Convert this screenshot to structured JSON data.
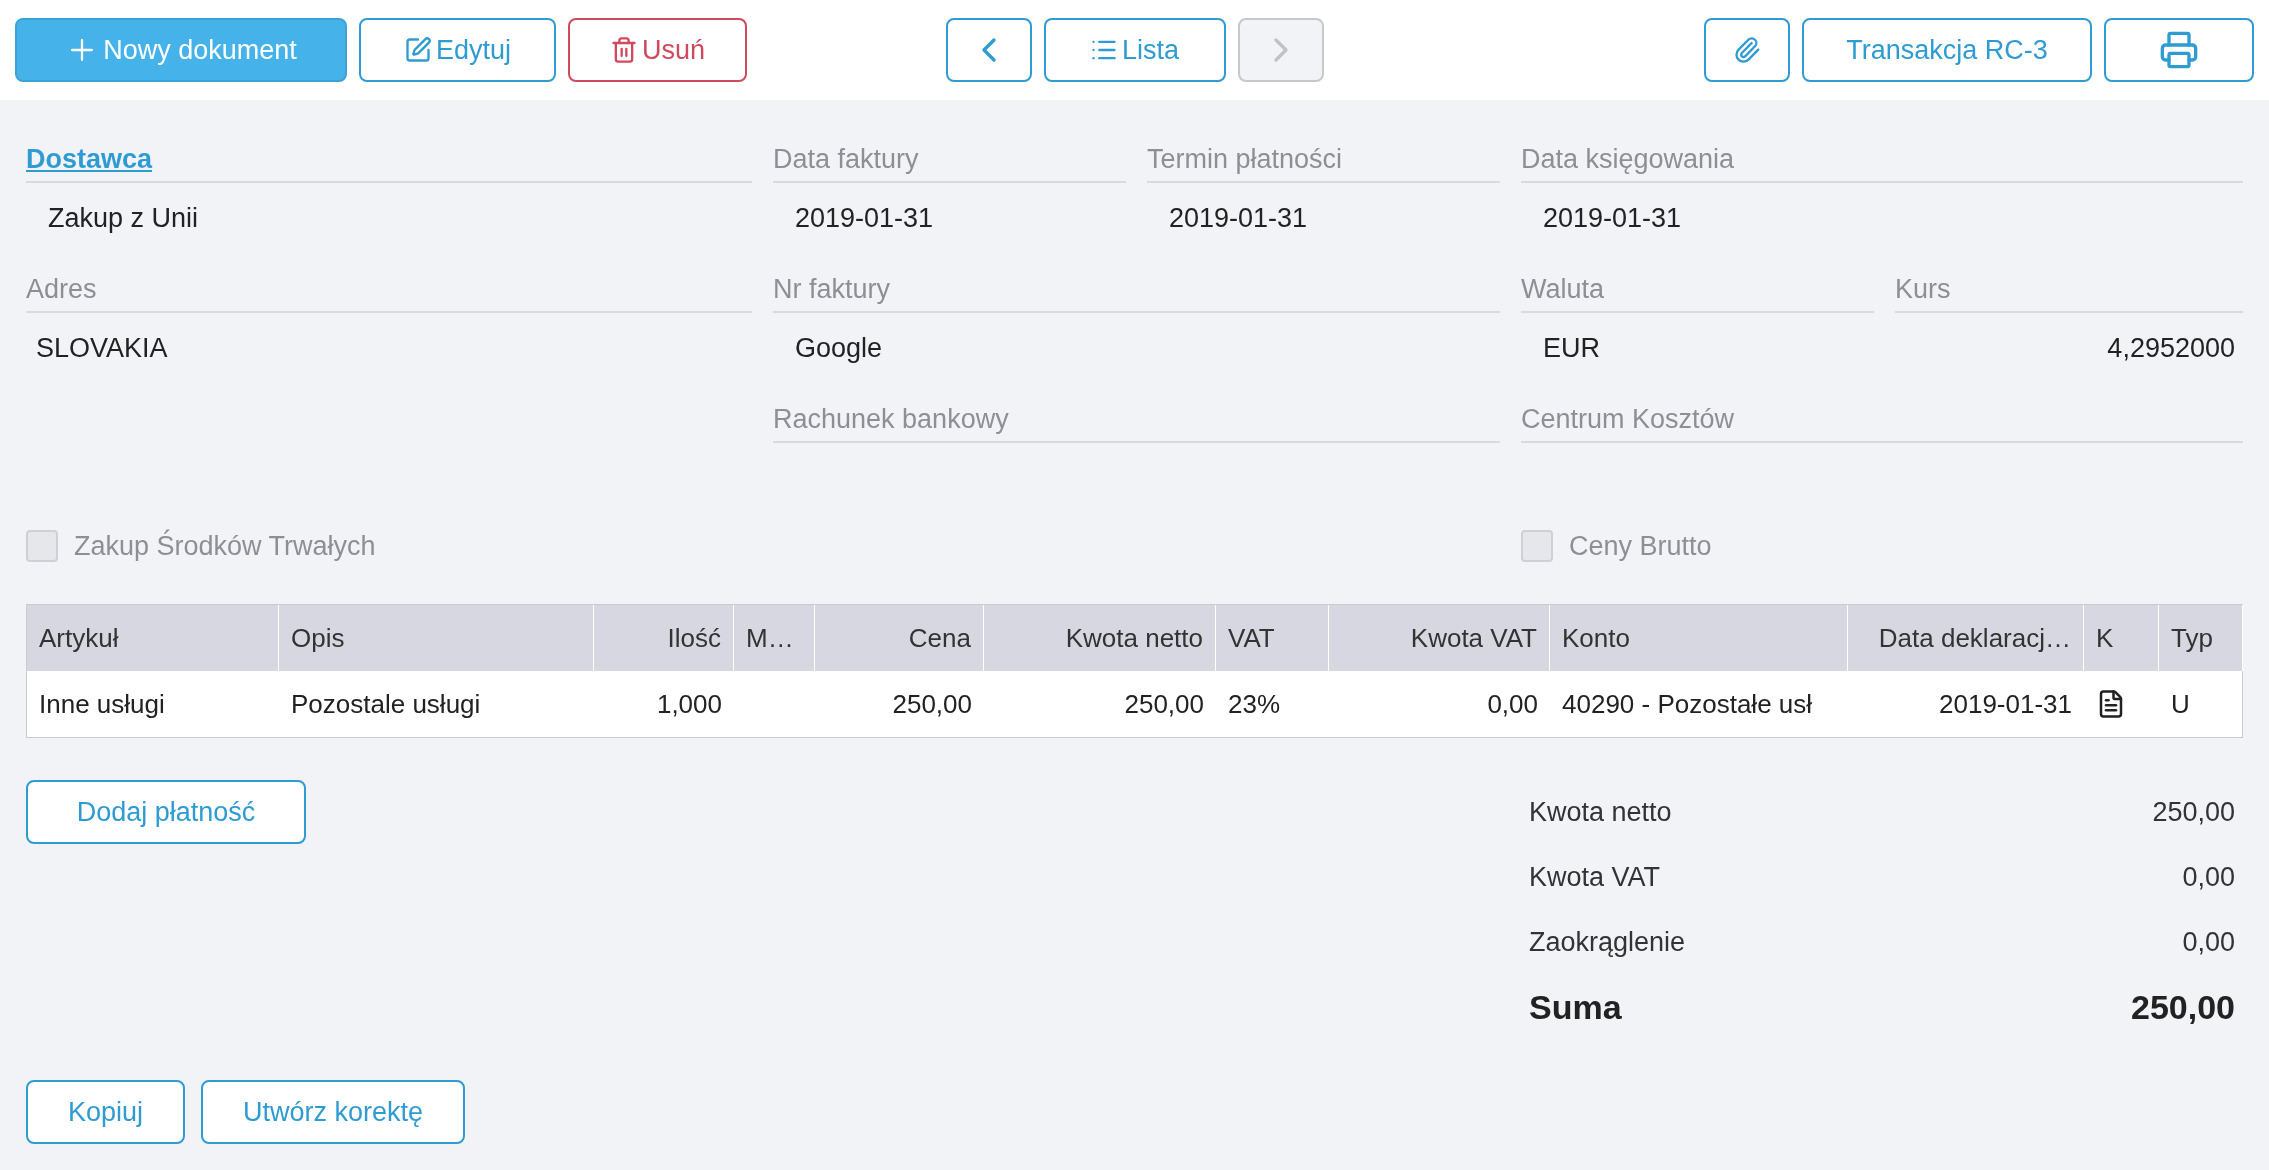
{
  "toolbar": {
    "new_button": {
      "label": "Nowy dokument"
    },
    "edit_button": {
      "label": "Edytuj"
    },
    "delete_button": {
      "label": "Usuń"
    },
    "prev_button": {
      "disabled": false
    },
    "list_button": {
      "label": "Lista"
    },
    "next_button": {
      "disabled": true
    },
    "transaction_button": {
      "label": "Transakcja RC-3"
    }
  },
  "form": {
    "supplier": {
      "label": "Dostawca",
      "value": "Zakup z Unii"
    },
    "invoice_date": {
      "label": "Data faktury",
      "value": "2019-01-31"
    },
    "due_date": {
      "label": "Termin płatności",
      "value": "2019-01-31"
    },
    "posting_date": {
      "label": "Data księgowania",
      "value": "2019-01-31"
    },
    "address": {
      "label": "Adres",
      "value": "SLOVAKIA"
    },
    "invoice_number": {
      "label": "Nr faktury",
      "value": "Google"
    },
    "currency": {
      "label": "Waluta",
      "value": "EUR"
    },
    "rate": {
      "label": "Kurs",
      "value": "4,2952000"
    },
    "bank_account": {
      "label": "Rachunek bankowy"
    },
    "cost_center": {
      "label": "Centrum Kosztów"
    }
  },
  "checkboxes": [
    {
      "label": "Zakup Środków Trwałych",
      "checked": false
    },
    {
      "label": "Ceny Brutto",
      "checked": false
    }
  ],
  "table": {
    "columns": [
      {
        "label": "Artykuł",
        "numeric": false
      },
      {
        "label": "Opis",
        "numeric": false
      },
      {
        "label": "Ilość",
        "numeric": true
      },
      {
        "label": "M…",
        "numeric": false
      },
      {
        "label": "Cena",
        "numeric": true
      },
      {
        "label": "Kwota netto",
        "numeric": true
      },
      {
        "label": "VAT",
        "numeric": false
      },
      {
        "label": "Kwota VAT",
        "numeric": true
      },
      {
        "label": "Konto",
        "numeric": false
      },
      {
        "label": "Data deklaracj…",
        "numeric": true
      },
      {
        "label": "K",
        "numeric": false
      },
      {
        "label": "Typ",
        "numeric": false
      }
    ],
    "rows": [
      {
        "cells": [
          "Inne usługi",
          "Pozostale usługi",
          "1,000",
          "",
          "250,00",
          "250,00",
          "23%",
          "0,00",
          "40290 - Pozostałe usł",
          "2019-01-31",
          null,
          "U"
        ]
      }
    ]
  },
  "add_payment_button": {
    "label": "Dodaj płatność"
  },
  "totals": [
    {
      "kind": "line",
      "label": "Kwota netto",
      "value": "250,00"
    },
    {
      "kind": "line",
      "label": "Kwota VAT",
      "value": "0,00"
    },
    {
      "kind": "line",
      "label": "Zaokrąglenie",
      "value": "0,00"
    },
    {
      "kind": "total",
      "label": "Suma",
      "value": "250,00"
    }
  ],
  "bottom_buttons": [
    {
      "label": "Kopiuj"
    },
    {
      "label": "Utwórz korektę"
    }
  ]
}
